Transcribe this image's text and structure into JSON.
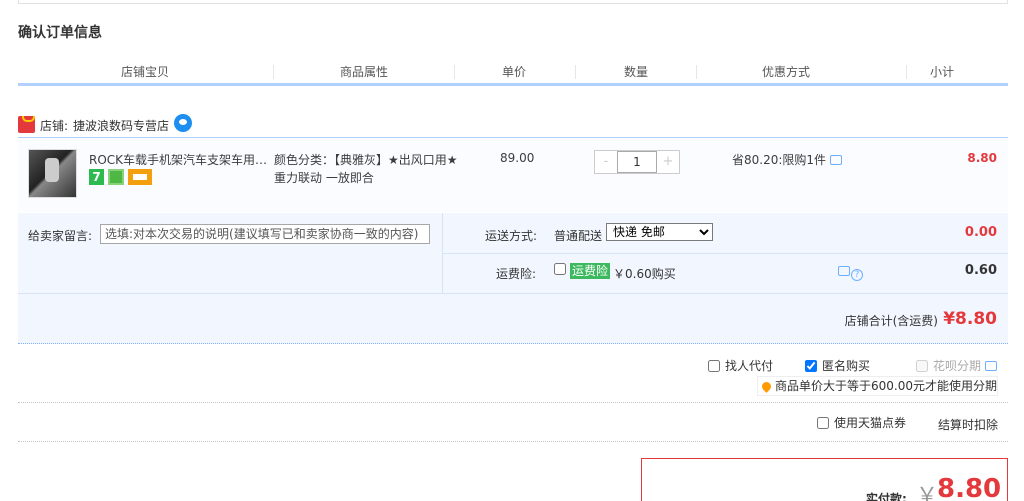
{
  "page": {
    "title": "确认订单信息"
  },
  "columns": [
    "店铺宝贝",
    "商品属性",
    "单价",
    "数量",
    "优惠方式",
    "小计"
  ],
  "shop": {
    "label": "店铺:",
    "name": "捷波浪数码专营店"
  },
  "item": {
    "title": "ROCK车载手机架汽车支架车用…",
    "badge_7": "7",
    "attributes": "颜色分类：【典雅灰】★出风口用★重力联动 一放即合",
    "price": "89.00",
    "quantity": "1",
    "qty_minus": "-",
    "qty_plus": "+",
    "discount": "省80.20:限购1件",
    "subtotal": "8.80"
  },
  "message": {
    "label": "给卖家留言:",
    "placeholder": "选填:对本次交易的说明(建议填写已和卖家协商一致的内容)"
  },
  "shipping": {
    "label": "运送方式:",
    "method": "普通配送",
    "selected": "快递 免邮",
    "fee": "0.00"
  },
  "insurance": {
    "label": "运费险:",
    "tag": "运费险",
    "price": "￥0.60购买",
    "help": "?",
    "fee": "0.60"
  },
  "shop_total": {
    "label": "店铺合计(含运费)",
    "value": "¥8.80"
  },
  "options": {
    "proxy_pay": "找人代付",
    "anonymous": "匿名购买",
    "installment": "花呗分期"
  },
  "tip": "商品单价大于等于600.00元才能使用分期",
  "coupon": {
    "label": "使用天猫点券",
    "note": "结算时扣除"
  },
  "payment": {
    "label": "实付款:",
    "yen": "￥",
    "amount": "8.80"
  },
  "colors": {
    "accent": "#e4393c",
    "header_line": "#b2d1ff",
    "panel_bg": "#f2f7ff"
  }
}
